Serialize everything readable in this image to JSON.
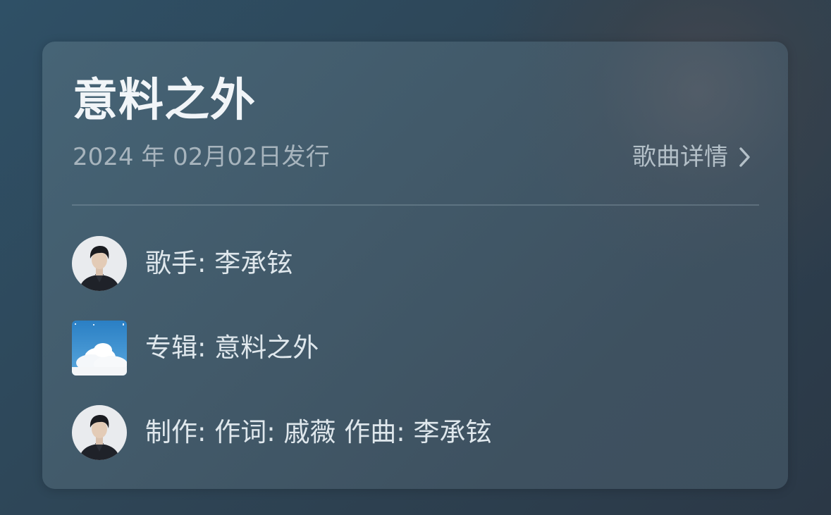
{
  "song": {
    "title": "意料之外",
    "release_date": "2024 年 02月02日发行",
    "detail_link_label": "歌曲详情"
  },
  "credits": [
    {
      "label": "歌手: 李承铉",
      "icon": "singer-avatar"
    },
    {
      "label": "专辑: 意料之外",
      "icon": "album-cover"
    },
    {
      "label": "制作: 作词: 戚薇 作曲: 李承铉",
      "icon": "producer-avatar"
    }
  ],
  "colors": {
    "title": "#f1f5f8",
    "secondary_text": "#a7b4bd",
    "body_text": "#dfe7ec",
    "card_background": "#425a6a",
    "page_background": "#2e4556",
    "cover_sky": "#2f86c8"
  }
}
